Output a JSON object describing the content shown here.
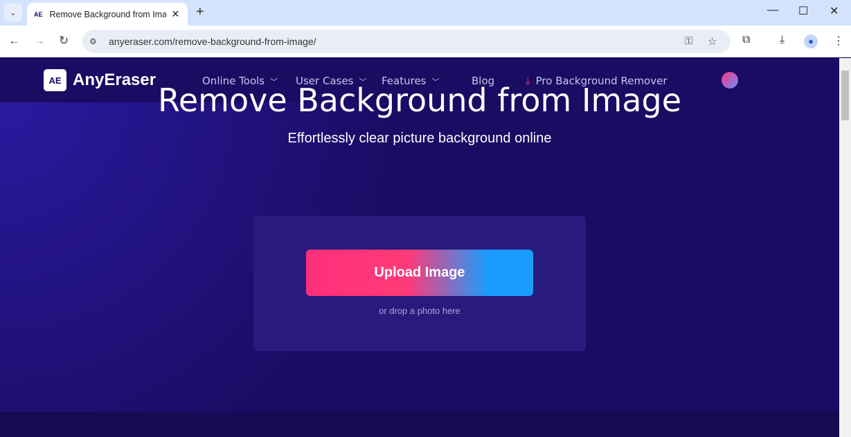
{
  "browser": {
    "tab_title": "Remove Background from Image",
    "tab_favicon": "AE",
    "url": "anyeraser.com/remove-background-from-image/"
  },
  "header": {
    "logo_mark": "AE",
    "logo_text": "AnyEraser",
    "menu": [
      {
        "label": "Online Tools"
      },
      {
        "label": "User Cases"
      },
      {
        "label": "Features"
      },
      {
        "label": "Blog"
      },
      {
        "label": "Pro Background Remover"
      }
    ]
  },
  "hero": {
    "title": "Remove Background from Image",
    "subtitle": "Effortlessly clear picture background online",
    "upload_label": "Upload Image",
    "drop_hint": "or drop a photo here"
  },
  "colors": {
    "bg": "#1a0b63",
    "accent_pink": "#ff2f7a",
    "accent_blue": "#1a9cff"
  }
}
